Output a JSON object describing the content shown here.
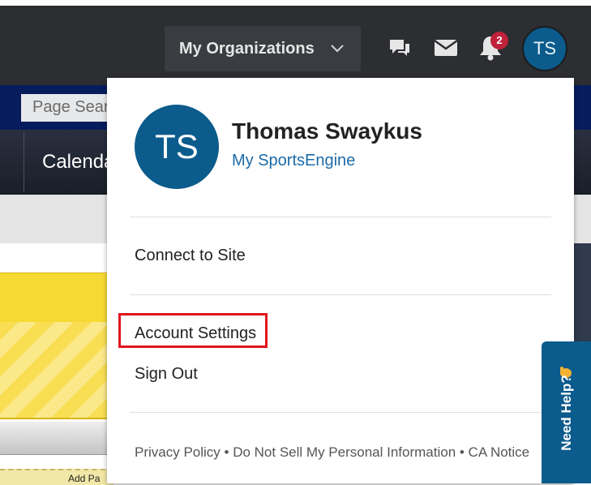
{
  "header": {
    "org_button_label": "My Organizations",
    "notification_count": "2",
    "user_initials": "TS"
  },
  "site": {
    "page_search_text": "Page Sear",
    "calendar_tab": "Calenda",
    "add_page_label": "Add Pa"
  },
  "dropdown": {
    "avatar_initials": "TS",
    "user_name": "Thomas Swaykus",
    "account_link": "My SportsEngine",
    "items": [
      {
        "label": "Connect to Site"
      },
      {
        "label": "Account Settings"
      },
      {
        "label": "Sign Out"
      }
    ],
    "footer": "Privacy Policy • Do Not Sell My Personal Information • CA Notice"
  },
  "help_widget": {
    "label": "Need Help?"
  },
  "colors": {
    "topbar": "#2c2e31",
    "avatar_blue": "#0b5b8c",
    "link_blue": "#1a6aa8",
    "badge_red": "#c0213b",
    "highlight_red": "#e1151d"
  }
}
